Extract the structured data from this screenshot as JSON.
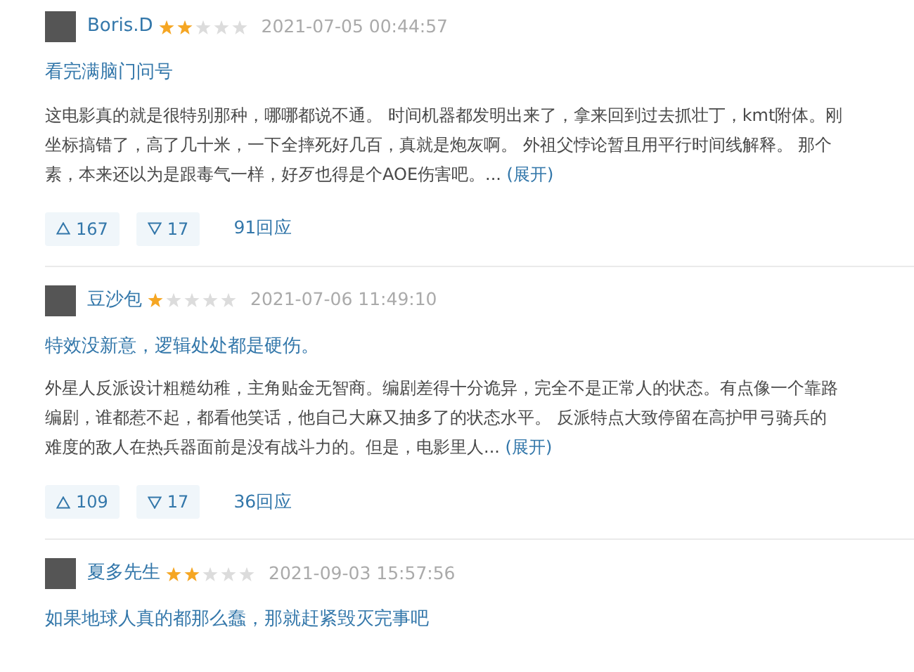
{
  "reviews": [
    {
      "user": "Boris.D",
      "stars": 2,
      "time": "2021-07-05 00:44:57",
      "title": "看完满脑门问号",
      "lines": [
        "这电影真的就是很特别那种，哪哪都说不通。 时间机器都发明出来了，拿来回到过去抓壮丁，kmt附体。刚",
        "坐标搞错了，高了几十米，一下全摔死好几百，真就是炮灰啊。 外祖父悖论暂且用平行时间线解释。 那个",
        "素，本来还以为是跟毒气一样，好歹也得是个AOE伤害吧。..."
      ],
      "expand": "(展开)",
      "up": "167",
      "down": "17",
      "replies": "91回应"
    },
    {
      "user": "豆沙包",
      "stars": 1,
      "time": "2021-07-06 11:49:10",
      "title": "特效没新意，逻辑处处都是硬伤。",
      "lines": [
        "外星人反派设计粗糙幼稚，主角贴金无智商。编剧差得十分诡异，完全不是正常人的状态。有点像一个靠路",
        "编剧，谁都惹不起，都看他笑话，他自己大麻又抽多了的状态水平。 反派特点大致停留在高护甲弓骑兵的",
        "难度的敌人在热兵器面前是没有战斗力的。但是，电影里人..."
      ],
      "expand": "(展开)",
      "up": "109",
      "down": "17",
      "replies": "36回应"
    },
    {
      "user": "夏多先生",
      "stars": 2,
      "time": "2021-09-03 15:57:56",
      "title": "如果地球人真的都那么蠢，那就赶紧毁灭完事吧"
    }
  ]
}
